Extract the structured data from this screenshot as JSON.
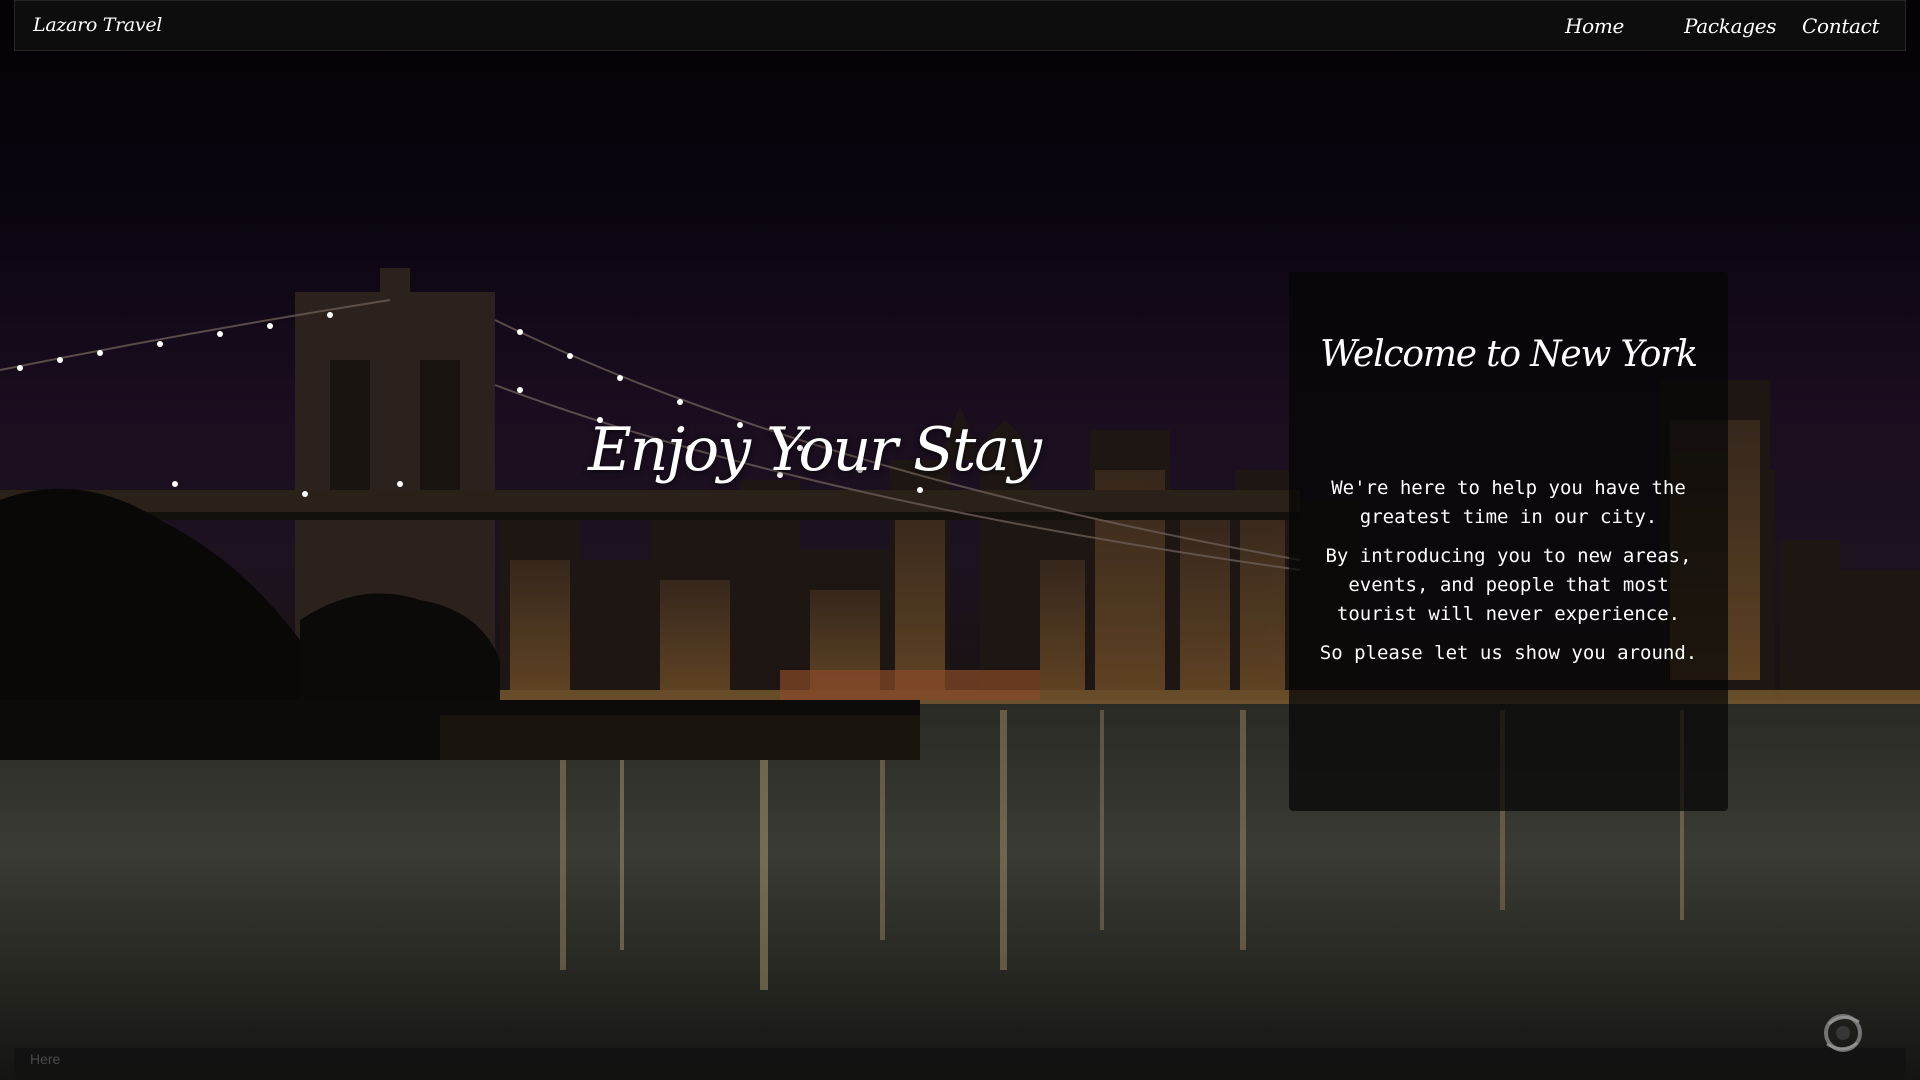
{
  "navbar": {
    "brand": "Lazaro Travel",
    "items": [
      {
        "label": "Home"
      },
      {
        "label": "Packages"
      },
      {
        "label": "Contact"
      }
    ]
  },
  "hero": {
    "title": "Enjoy Your Stay"
  },
  "welcome_panel": {
    "title": "Welcome to New York",
    "paragraphs": [
      "We're here to help you have the greatest time in our city.",
      "By introducing you to new areas, events, and people that most tourist will never experience.",
      "So please let us show you around."
    ]
  },
  "footer": {
    "text": "Here"
  },
  "icons": {
    "corner_logo": "aperture-logo-icon"
  },
  "colors": {
    "navbar_bg": "#0e0e0e",
    "panel_bg": "#060606",
    "text": "#ffffff",
    "footer_text": "#4a4a4a"
  }
}
